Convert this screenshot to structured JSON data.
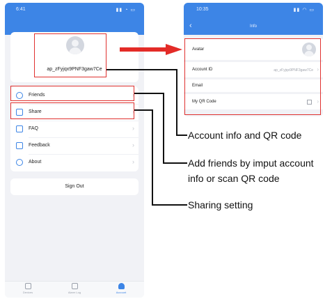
{
  "left_screen": {
    "status_time": "6:41",
    "account_id": "ap_zFyjqx9PNF3gaw7Ce",
    "menu": [
      {
        "label": "Friends",
        "icon": "person-icon"
      },
      {
        "label": "Share",
        "icon": "share-icon"
      },
      {
        "label": "FAQ",
        "icon": "faq-icon"
      },
      {
        "label": "Feedback",
        "icon": "feedback-icon"
      },
      {
        "label": "About",
        "icon": "info-icon"
      }
    ],
    "sign_out": "Sign Out",
    "tabs": [
      {
        "label": "Devices",
        "icon": "home-icon"
      },
      {
        "label": "Alarm Log",
        "icon": "log-icon"
      },
      {
        "label": "Account",
        "icon": "account-icon"
      }
    ]
  },
  "right_screen": {
    "status_time": "10:35",
    "title": "Info",
    "rows": {
      "avatar": "Avatar",
      "account_id": "Account ID",
      "account_id_value": "ap_zFyjqx9PNF3gaw7Ce",
      "email": "Email",
      "qr": "My QR Code"
    }
  },
  "annotations": {
    "info": "Account info and QR code",
    "friends_line1": "Add friends by imput account",
    "friends_line2": "info or scan QR code",
    "share": "Sharing setting"
  },
  "colors": {
    "header_blue": "#3d85e6",
    "highlight_red": "#e0312f",
    "arrow_red": "#e32b27"
  }
}
